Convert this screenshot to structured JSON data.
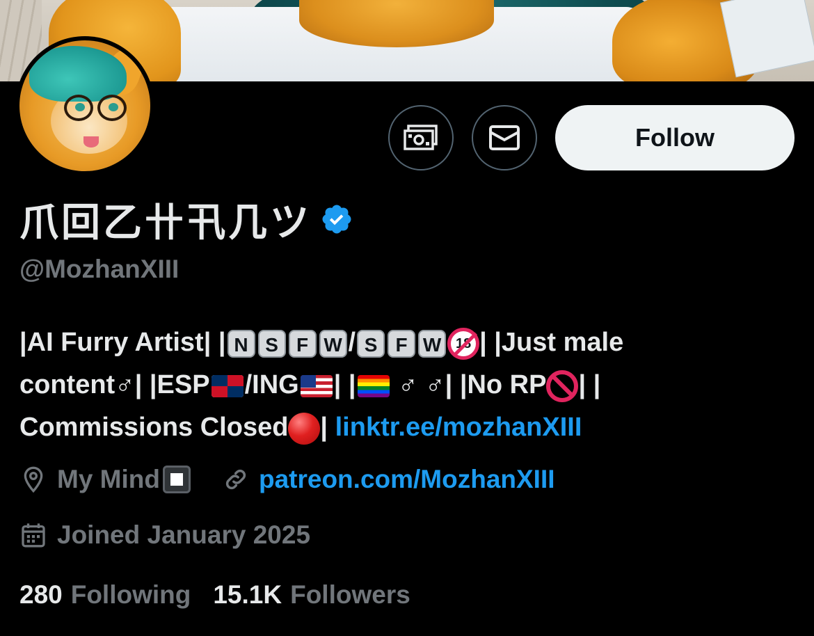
{
  "profile": {
    "display_name": "爪回乙卄卂几ツ",
    "handle": "@MozhanXIII",
    "verified": true,
    "follow_label": "Follow"
  },
  "bio": {
    "line1_a": "|AI Furry Artist| |",
    "nsfw_keys": [
      "N",
      "S",
      "F",
      "W"
    ],
    "slash": "/",
    "sfw_keys": [
      "S",
      "F",
      "W"
    ],
    "badge_18": "18",
    "line1_b": "| |Just male",
    "line2_a": "content♂| |ESP",
    "line2_b": "/ING",
    "line2_c": "| |",
    "line2_d": "♂ ♂| |No RP",
    "line2_e": "| |",
    "line3_a": "Commissions Closed",
    "line3_b": "| ",
    "link": "linktr.ee/mozhanXIII"
  },
  "meta": {
    "location": "My Mind",
    "website": "patreon.com/MozhanXIII",
    "joined": "Joined January 2025"
  },
  "stats": {
    "following_count": "280",
    "following_label": "Following",
    "followers_count": "15.1K",
    "followers_label": "Followers"
  },
  "icons": {
    "tip": "money-icon",
    "message": "envelope-icon",
    "verified": "verified-badge-icon",
    "location": "location-pin-icon",
    "link": "link-icon",
    "calendar": "calendar-icon"
  },
  "colors": {
    "background": "#000000",
    "text": "#e7e9ea",
    "secondary_text": "#71767b",
    "link": "#1d9bf0",
    "verified": "#1d9bf0",
    "follow_button_bg": "#eff3f4"
  }
}
